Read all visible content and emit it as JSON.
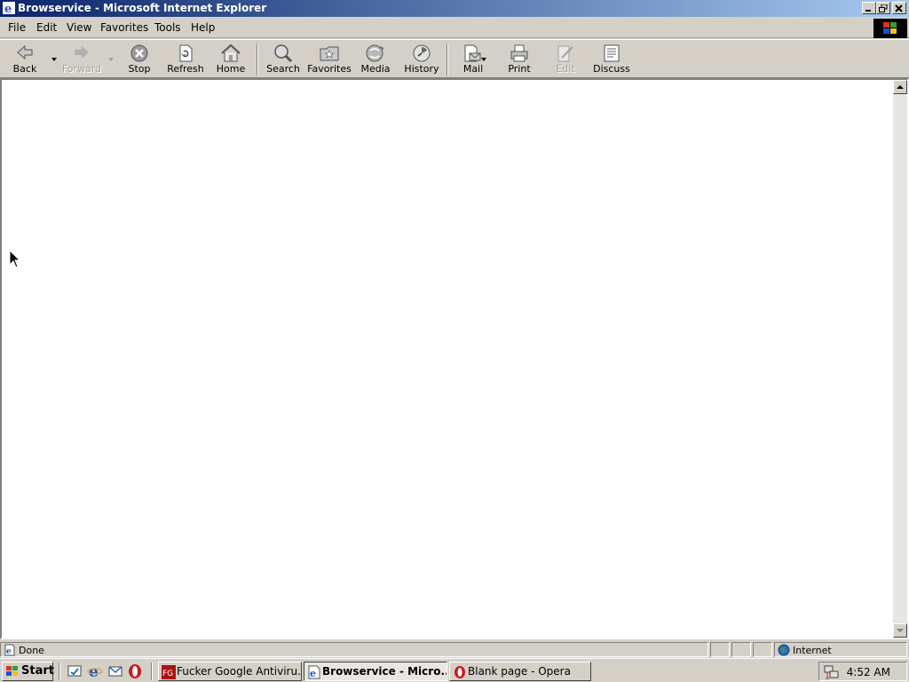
{
  "window": {
    "title": "Browservice - Microsoft Internet Explorer",
    "minimize_icon": "minimize-icon",
    "restore_icon": "restore-icon",
    "close_icon": "close-icon"
  },
  "menu": {
    "items": [
      {
        "label": "File"
      },
      {
        "label": "Edit"
      },
      {
        "label": "View"
      },
      {
        "label": "Favorites"
      },
      {
        "label": "Tools"
      },
      {
        "label": "Help"
      }
    ]
  },
  "toolbar": {
    "buttons": [
      {
        "label": "Back",
        "icon": "back-arrow-icon",
        "enabled": true
      },
      {
        "label": "Forward",
        "icon": "forward-arrow-icon",
        "enabled": false
      },
      {
        "label": "Stop",
        "icon": "stop-icon",
        "enabled": true
      },
      {
        "label": "Refresh",
        "icon": "refresh-icon",
        "enabled": true
      },
      {
        "label": "Home",
        "icon": "home-icon",
        "enabled": true
      },
      {
        "label": "Search",
        "icon": "search-icon",
        "enabled": true
      },
      {
        "label": "Favorites",
        "icon": "favorites-icon",
        "enabled": true
      },
      {
        "label": "Media",
        "icon": "media-icon",
        "enabled": true
      },
      {
        "label": "History",
        "icon": "history-icon",
        "enabled": true
      },
      {
        "label": "Mail",
        "icon": "mail-icon",
        "enabled": true
      },
      {
        "label": "Print",
        "icon": "print-icon",
        "enabled": true
      },
      {
        "label": "Edit",
        "icon": "edit-icon",
        "enabled": false
      },
      {
        "label": "Discuss",
        "icon": "discuss-icon",
        "enabled": true
      }
    ]
  },
  "statusbar": {
    "status": "Done",
    "zone": "Internet"
  },
  "taskbar": {
    "start_label": "Start",
    "tasks": [
      {
        "label": "Fucker Google Antiviru...",
        "icon": "fg-app-icon",
        "active": false
      },
      {
        "label": "Browservice - Micro...",
        "icon": "ie-icon",
        "active": true
      },
      {
        "label": "Blank page - Opera",
        "icon": "opera-icon",
        "active": false
      }
    ],
    "clock": "4:52 AM"
  },
  "colors": {
    "titlebar_start": "#0a246a",
    "titlebar_end": "#a6caf0",
    "face": "#d4d0c8"
  }
}
